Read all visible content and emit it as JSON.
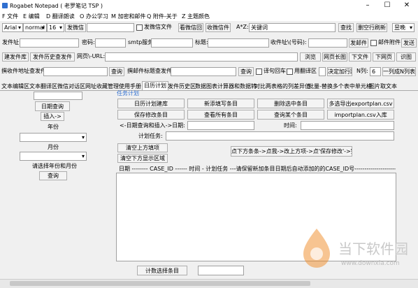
{
  "window": {
    "title": "Rogabet Notepad ( 老罗笔记 TSP )"
  },
  "menu": [
    "F 文件",
    "E 编辑",
    "D 翻译朗读",
    "O 办公学习",
    "M 加密和邮件",
    "Q 附件-关于",
    "Z 主题颜色"
  ],
  "toolbar1": {
    "font": "Arial",
    "style": "normal",
    "size": "16",
    "wechat_btn": "发微信",
    "wechat_file_chk": "发微信文件",
    "view_wechat_btn": "看微信回",
    "recv_wechat_btn": "收微信件",
    "az_label": "A*Z:",
    "keyword": "关键词",
    "find_btn": "查找",
    "delete_blank_btn": "删空行刷新",
    "theme": "昱晚"
  },
  "toolbar2": {
    "sender_label": "发件址:",
    "password_label": "密码:",
    "smtp_label": "smtp服务",
    "subject_label": "标题:",
    "recipient_label": "收件址\\(号码):",
    "send_btn": "发邮件",
    "mail_attach_chk": "邮件附件",
    "send2_btn": "发送"
  },
  "toolbar3": {
    "build_btn": "建发件库",
    "history_btn": "发件历史查发件",
    "url_label": "网页\\-URL:",
    "browse_btn": "浏览",
    "longshot_btn": "网页长图",
    "download_btn": "下文件",
    "download_page_btn": "下网页",
    "ocr_btn": "识图"
  },
  "toolbar4": {
    "recv_query_label": "撰收件地址查发件:",
    "query1_btn": "查询",
    "mail_subject_label": "撰邮件标题查发件:",
    "query2_btn": "查询",
    "quote_chk": "译句回车",
    "translate_chk": "用翻译区",
    "widen_btn": "决定加行距",
    "ncol_label": "N列:",
    "ncol_value": "6",
    "ncol_btn": "一列成N列表"
  },
  "tabs": [
    "文本编辑区",
    "文本翻译区",
    "微信对话区",
    "网址收藏管理",
    "使用手册",
    "日历计划",
    "发件历史区",
    "数据图表",
    "计算器和数据转",
    "对比两表格的列差异值",
    "批量-替换多个表中单元格",
    "图片取文本"
  ],
  "left": {
    "date_query_btn": "日期查询",
    "insert_btn": "插入->",
    "year_label": "年份",
    "month_label": "月份",
    "pick_label": "请选择年份和月份",
    "query_btn": "查询"
  },
  "plan": {
    "group_label": "任务计划",
    "create_btn": "日历计划建库",
    "new_btn": "新添填写条目",
    "delete_btn": "删除选中条目",
    "export_btn": "多选导出exportplan.csv",
    "save_btn": "保存修改条目",
    "view_all_btn": "查看所有条目",
    "query_one_btn": "查询某个条目",
    "import_btn": "importplan.csv入库",
    "date_label": "<-日期查询和插入->日期:",
    "time_label": "时间:",
    "task_label": "计划任务:",
    "clear_top_btn": "清空上方填项",
    "clear_bottom_btn": "清空下方显示区域",
    "hint_btn": "点下方条条->点我->改上方项->点'保存修改'->完成",
    "grid_header": "日期 -------- CASE_ID ------ 时间 - 计划任务 ---请保留新加条目日期后自动添加的的CASE_ID号------------------------------------------------",
    "count_btn": "计数选择条目"
  },
  "watermark": {
    "text": "当下软件园",
    "url": "www.downxia.com"
  },
  "colors": {
    "accent": "#2f6fd0",
    "logo_orange": "#f08a24"
  }
}
